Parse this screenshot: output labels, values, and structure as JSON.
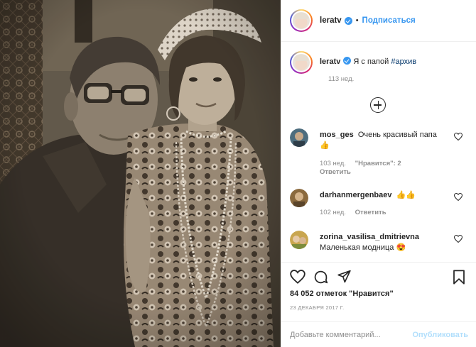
{
  "post": {
    "author": "leratv",
    "follow_label": "Подписаться",
    "separator": "•",
    "caption_text": "Я с папой",
    "caption_hashtag": "#архив",
    "caption_time": "113 нед.",
    "likes": "84 052 отметок \"Нравится\"",
    "date": "23 ДЕКАБРЯ 2017 Г.",
    "comment_placeholder": "Добавьте комментарий...",
    "publish_label": "Опубликовать"
  },
  "comments": [
    {
      "user": "mos_ges",
      "text": "Очень красивый папа",
      "emoji": "👍",
      "time": "103 нед.",
      "likes": "\"Нравится\": 2",
      "reply": "Ответить"
    },
    {
      "user": "darhanmergenbaev",
      "text": "",
      "emoji": "👍👍",
      "time": "102 нед.",
      "likes": "",
      "reply": "Ответить"
    },
    {
      "user": "zorina_vasilisa_dmitrievna",
      "text": "Маленькая модница",
      "emoji": "😍"
    }
  ],
  "icons": {
    "verified": "verified-badge-icon",
    "load_more": "plus-circle-icon",
    "like": "heart-icon",
    "comment": "comment-bubble-icon",
    "share": "paper-plane-icon",
    "save": "bookmark-icon"
  },
  "colors": {
    "accent": "#3897f0",
    "muted": "#8e8e8e",
    "publish_disabled": "#b2dffc",
    "border": "#efefef"
  }
}
